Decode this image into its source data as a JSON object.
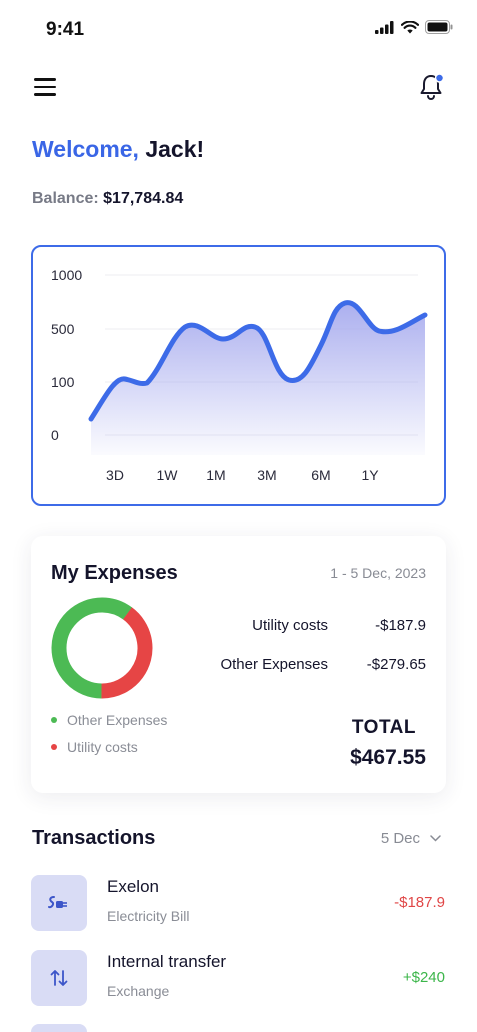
{
  "status": {
    "time": "9:41"
  },
  "greeting": {
    "hello": "Welcome,",
    "name": "Jack!"
  },
  "balance": {
    "label": "Balance:",
    "value": "$17,784.84"
  },
  "chart_data": {
    "type": "area",
    "y_tick_labels": [
      "1000",
      "500",
      "100",
      "0"
    ],
    "x_tick_labels": [
      "3D",
      "1W",
      "1M",
      "3M",
      "6M",
      "1Y"
    ],
    "line_color": "#3d6be8",
    "fill_color": "#a7abee",
    "grid": true
  },
  "expenses": {
    "title": "My Expenses",
    "date_range": "1 - 5 Dec, 2023",
    "items": [
      {
        "name": "Utility costs",
        "amount": "-$187.9",
        "color": "#e64545",
        "value": 187.9
      },
      {
        "name": "Other Expenses",
        "amount": "-$279.65",
        "color": "#4cba54",
        "value": 279.65
      }
    ],
    "legend": [
      {
        "label": "Other Expenses",
        "color": "#4cba54"
      },
      {
        "label": "Utility costs",
        "color": "#e64545"
      }
    ],
    "total_label": "TOTAL",
    "total_value": "$467.55"
  },
  "transactions": {
    "title": "Transactions",
    "filter": "5 Dec",
    "items": [
      {
        "name": "Exelon",
        "category": "Electricity Bill",
        "amount": "-$187.9",
        "icon": "plug-icon"
      },
      {
        "name": "Internal transfer",
        "category": "Exchange",
        "amount": "+$240",
        "icon": "transfer-arrows-icon"
      }
    ]
  },
  "colors": {
    "accent": "#3d6be8",
    "negative": "#e04646",
    "positive": "#3cb64a",
    "icon_bg": "#d9dcf5"
  }
}
